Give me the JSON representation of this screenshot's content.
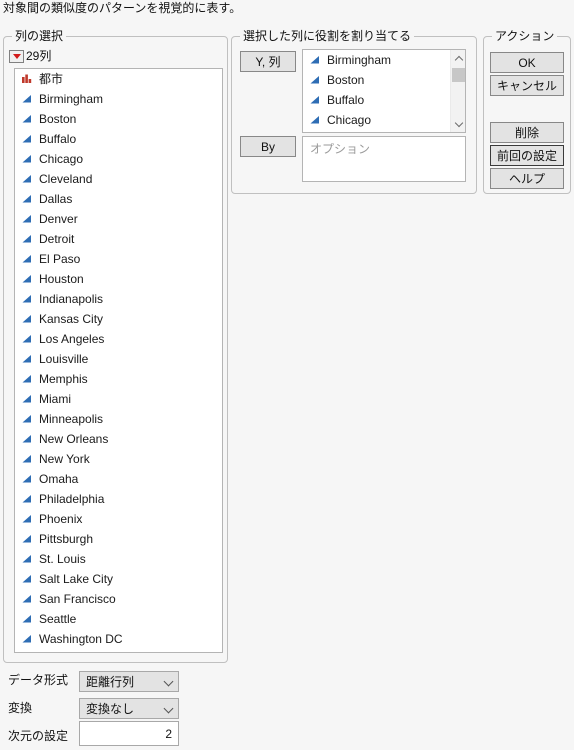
{
  "header": {
    "description": "対象間の類似度のパターンを視覚的に表す。"
  },
  "column_selection": {
    "legend": "列の選択",
    "count_label": "29列",
    "dropdown_icon": "red-triangle-down-icon",
    "items": [
      {
        "label": "都市",
        "icon": "nominal-bars-icon"
      },
      {
        "label": "Birmingham",
        "icon": "continuous-triangle-icon"
      },
      {
        "label": "Boston",
        "icon": "continuous-triangle-icon"
      },
      {
        "label": "Buffalo",
        "icon": "continuous-triangle-icon"
      },
      {
        "label": "Chicago",
        "icon": "continuous-triangle-icon"
      },
      {
        "label": "Cleveland",
        "icon": "continuous-triangle-icon"
      },
      {
        "label": "Dallas",
        "icon": "continuous-triangle-icon"
      },
      {
        "label": "Denver",
        "icon": "continuous-triangle-icon"
      },
      {
        "label": "Detroit",
        "icon": "continuous-triangle-icon"
      },
      {
        "label": "El Paso",
        "icon": "continuous-triangle-icon"
      },
      {
        "label": "Houston",
        "icon": "continuous-triangle-icon"
      },
      {
        "label": "Indianapolis",
        "icon": "continuous-triangle-icon"
      },
      {
        "label": "Kansas City",
        "icon": "continuous-triangle-icon"
      },
      {
        "label": "Los Angeles",
        "icon": "continuous-triangle-icon"
      },
      {
        "label": "Louisville",
        "icon": "continuous-triangle-icon"
      },
      {
        "label": "Memphis",
        "icon": "continuous-triangle-icon"
      },
      {
        "label": "Miami",
        "icon": "continuous-triangle-icon"
      },
      {
        "label": "Minneapolis",
        "icon": "continuous-triangle-icon"
      },
      {
        "label": "New Orleans",
        "icon": "continuous-triangle-icon"
      },
      {
        "label": "New York",
        "icon": "continuous-triangle-icon"
      },
      {
        "label": "Omaha",
        "icon": "continuous-triangle-icon"
      },
      {
        "label": "Philadelphia",
        "icon": "continuous-triangle-icon"
      },
      {
        "label": "Phoenix",
        "icon": "continuous-triangle-icon"
      },
      {
        "label": "Pittsburgh",
        "icon": "continuous-triangle-icon"
      },
      {
        "label": "St. Louis",
        "icon": "continuous-triangle-icon"
      },
      {
        "label": "Salt Lake City",
        "icon": "continuous-triangle-icon"
      },
      {
        "label": "San Francisco",
        "icon": "continuous-triangle-icon"
      },
      {
        "label": "Seattle",
        "icon": "continuous-triangle-icon"
      },
      {
        "label": "Washington DC",
        "icon": "continuous-triangle-icon"
      }
    ]
  },
  "bottom_controls": {
    "data_format": {
      "label": "データ形式",
      "value": "距離行列"
    },
    "transform": {
      "label": "変換",
      "value": "変換なし"
    },
    "dimensions": {
      "label": "次元の設定",
      "value": "2"
    }
  },
  "roles": {
    "legend": "選択した列に役割を割り当てる",
    "y_button": "Y, 列",
    "by_button": "By",
    "y_items": [
      {
        "label": "Birmingham",
        "icon": "continuous-triangle-icon"
      },
      {
        "label": "Boston",
        "icon": "continuous-triangle-icon"
      },
      {
        "label": "Buffalo",
        "icon": "continuous-triangle-icon"
      },
      {
        "label": "Chicago",
        "icon": "continuous-triangle-icon"
      }
    ],
    "options_placeholder": "オプション"
  },
  "action": {
    "legend": "アクション",
    "ok": "OK",
    "cancel": "キャンセル",
    "remove": "削除",
    "recall": "前回の設定",
    "help": "ヘルプ"
  },
  "colors": {
    "page_background": "#f6f6f6",
    "listbox_background": "#ffffff",
    "button_face": "#e3e3e3",
    "continuous_icon": "#2e6db4",
    "nominal_icon": "#c0392b",
    "placeholder_text": "#9a9a9a"
  }
}
